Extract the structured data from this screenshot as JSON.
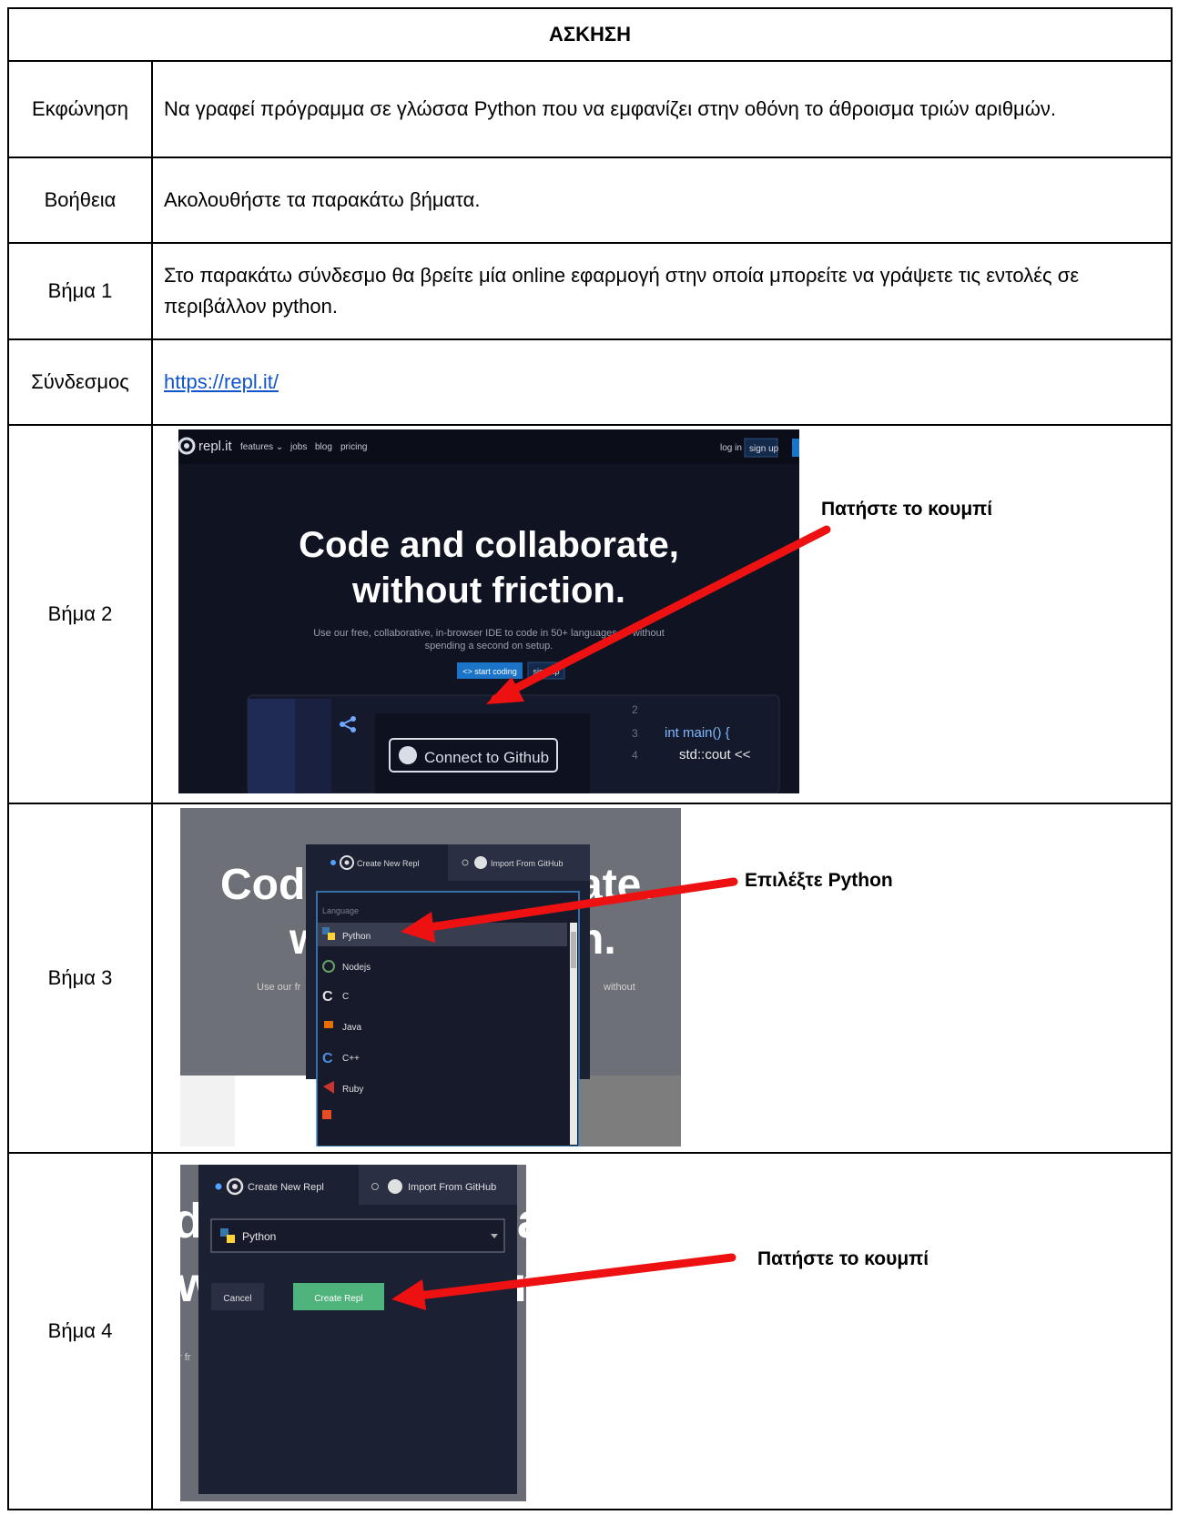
{
  "title": "ΑΣΚΗΣΗ",
  "rows": {
    "statement": {
      "label": "Εκφώνηση",
      "text": "Να γραφεί πρόγραμμα σε γλώσσα Python που να εμφανίζει στην οθόνη το άθροισμα τριών αριθμών."
    },
    "help": {
      "label": "Βοήθεια",
      "text": "Ακολουθήστε τα παρακάτω βήματα."
    },
    "step1": {
      "label": "Βήμα 1",
      "text": "Στο παρακάτω σύνδεσμο θα βρείτε μία online εφαρμογή στην οποία μπορείτε να γράψετε τις εντολές σε περιβάλλον python."
    },
    "link": {
      "label": "Σύνδεσμος",
      "url": "https://repl.it/"
    },
    "step2": {
      "label": "Βήμα 2",
      "note": "Πατήστε το κουμπί",
      "shot": {
        "logo": "repl.it",
        "nav": [
          "features ⌄",
          "jobs",
          "blog",
          "pricing"
        ],
        "login": "log in",
        "signup": "sign up",
        "headline1": "Code and collaborate,",
        "headline2": "without friction.",
        "sub1": "Use our free, collaborative, in-browser IDE to code in 50+ languages — without",
        "sub2": "spending a second on setup.",
        "start_btn": "<> start coding",
        "signup_btn": "sign up",
        "code_line2": "2",
        "code_line3": "3",
        "code_line4": "4",
        "code3": "int main() {",
        "code4": "std::cout <<",
        "connect": "Connect to Github"
      }
    },
    "step3": {
      "label": "Βήμα 3",
      "note": "Επιλέξτε Python",
      "shot": {
        "tab_new": "Create New Repl",
        "tab_import": "Import From GitHub",
        "bg1a": "Cod",
        "bg1b": "ate.",
        "bg2a": "w",
        "bg2b": "n.",
        "bg3a": "Use our fr",
        "bg3b": "without",
        "list_header": "Language",
        "languages": [
          "Python",
          "Nodejs",
          "C",
          "Java",
          "C++",
          "Ruby"
        ]
      }
    },
    "step4": {
      "label": "Βήμα 4",
      "note": "Πατήστε το κουμπί",
      "shot": {
        "tab_new": "Create New Repl",
        "tab_import": "Import From GitHub",
        "selected": "Python",
        "cancel": "Cancel",
        "create": "Create Repl",
        "bg1": "d",
        "bg2": "w",
        "bg3": "n",
        "bg4": "a",
        "bg5": "r fr"
      }
    }
  },
  "colors": {
    "arrow": "#ee1111",
    "link": "#1155cc",
    "create_button": "#4fb37c",
    "start_button": "#1b74c8"
  }
}
